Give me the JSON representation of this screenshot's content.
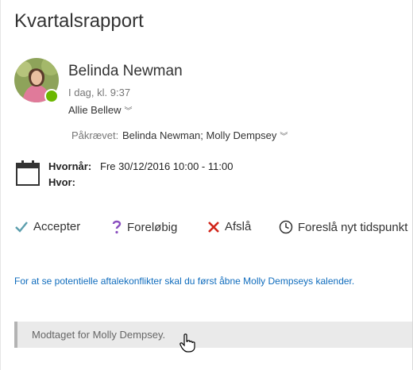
{
  "meeting": {
    "title": "Kvartalsrapport"
  },
  "sender": {
    "name": "Belinda Newman",
    "time": "I dag, kl. 9:37",
    "to": "Allie Bellew"
  },
  "required": {
    "label": "Påkrævet:",
    "names": "Belinda Newman; Molly Dempsey"
  },
  "details": {
    "when_label": "Hvornår:",
    "when_value": "Fre 30/12/2016 10:00 - 11:00",
    "where_label": "Hvor:"
  },
  "actions": {
    "accept": "Accepter",
    "tentative": "Foreløbig",
    "decline": "Afslå",
    "propose": "Foreslå nyt tidspunkt"
  },
  "conflict_link": "For at se potentielle aftalekonflikter skal du først åbne Molly Dempseys kalender.",
  "status_text": "Modtaget for Molly Dempsey.",
  "icons": {
    "accept": "checkmark-icon",
    "tentative": "question-mark-icon",
    "decline": "x-icon",
    "propose": "clock-icon",
    "calendar": "calendar-icon",
    "presence": "presence-available-icon",
    "cursor": "hand-pointer-icon"
  },
  "colors": {
    "accept": "#5c9ead",
    "tentative": "#8a4fbf",
    "decline": "#d1251a",
    "link": "#0f6cbd",
    "presence": "#6bb700"
  }
}
